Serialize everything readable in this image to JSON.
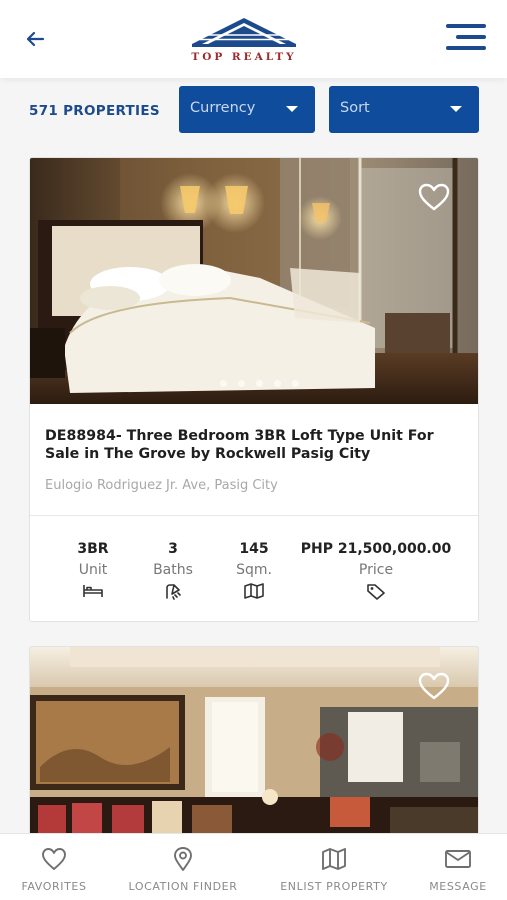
{
  "header": {
    "logo_text": "TOP REALTY",
    "back_icon": "arrow-left-icon",
    "menu_icon": "hamburger-menu-icon",
    "accent_color": "#1d4a8d"
  },
  "toolbar": {
    "count_label": "571 PROPERTIES",
    "currency_label": "Currency",
    "sort_label": "Sort"
  },
  "listings": [
    {
      "title": "DE88984- Three Bedroom 3BR Loft Type Unit For Sale in The Grove by Rockwell Pasig City",
      "address": "Eulogio Rodriguez Jr. Ave, Pasig City",
      "stats": [
        {
          "value": "3BR",
          "label": "Unit",
          "icon": "bed-icon"
        },
        {
          "value": "3",
          "label": "Baths",
          "icon": "shower-icon"
        },
        {
          "value": "145",
          "label": "Sqm.",
          "icon": "map-icon"
        },
        {
          "value": "PHP 21,500,000.00",
          "label": "Price",
          "icon": "tag-icon"
        }
      ]
    }
  ],
  "tabbar": {
    "items": [
      {
        "label": "FAVORITES",
        "icon": "heart-icon"
      },
      {
        "label": "LOCATION FINDER",
        "icon": "map-pin-icon"
      },
      {
        "label": "ENLIST PROPERTY",
        "icon": "map-icon"
      },
      {
        "label": "MESSAGE",
        "icon": "envelope-icon"
      }
    ]
  }
}
